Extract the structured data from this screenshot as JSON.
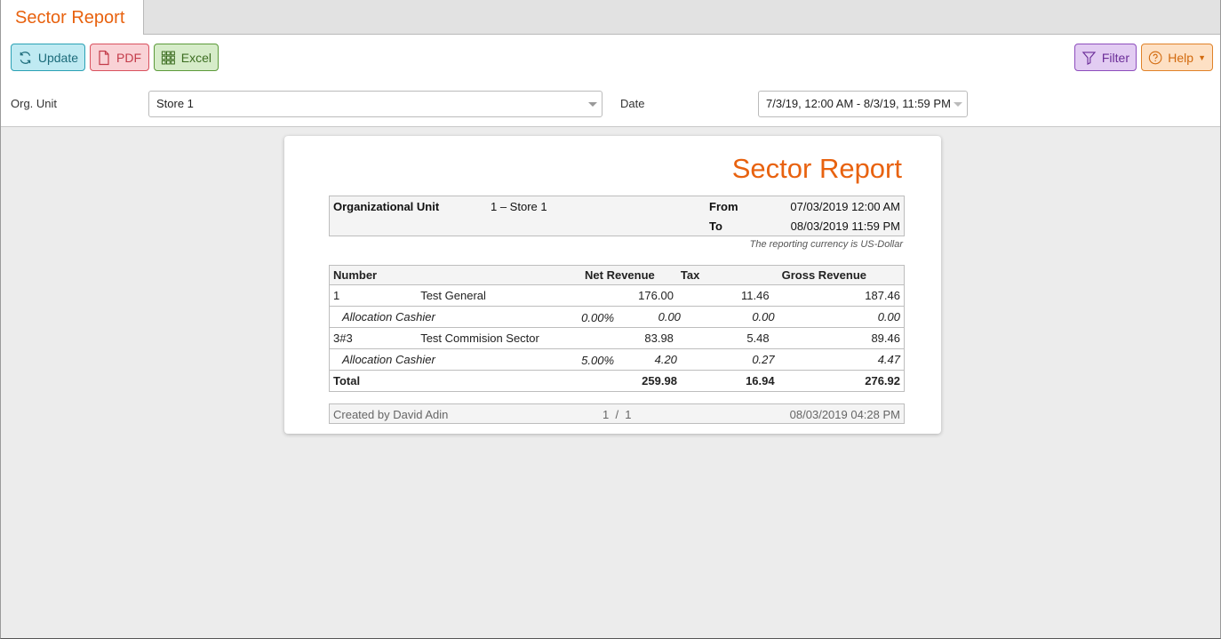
{
  "tab": {
    "label": "Sector Report"
  },
  "toolbar": {
    "update_label": "Update",
    "pdf_label": "PDF",
    "excel_label": "Excel",
    "filter_label": "Filter",
    "help_label": "Help"
  },
  "filters": {
    "org_unit_label": "Org. Unit",
    "org_unit_value": "Store 1",
    "date_label": "Date",
    "date_value": "7/3/19, 12:00 AM - 8/3/19, 11:59 PM"
  },
  "report": {
    "title": "Sector Report",
    "info": {
      "org_unit_label": "Organizational Unit",
      "org_unit_value": "1 – Store 1",
      "from_label": "From",
      "from_value": "07/03/2019 12:00 AM",
      "to_label": "To",
      "to_value": "08/03/2019 11:59 PM"
    },
    "currency_note": "The reporting currency is US-Dollar",
    "columns": {
      "number": "Number",
      "net_revenue": "Net Revenue",
      "tax": "Tax",
      "gross_revenue": "Gross Revenue"
    },
    "rows": [
      {
        "number": "1",
        "name": "Test General",
        "pct": "",
        "net": "176.00",
        "tax": "11.46",
        "gross": "187.46"
      },
      {
        "number": "",
        "name": "Allocation Cashier",
        "pct": "0.00%",
        "net": "0.00",
        "tax": "0.00",
        "gross": "0.00"
      },
      {
        "number": "3#3",
        "name": "Test Commision Sector",
        "pct": "",
        "net": "83.98",
        "tax": "5.48",
        "gross": "89.46"
      },
      {
        "number": "",
        "name": "Allocation Cashier",
        "pct": "5.00%",
        "net": "4.20",
        "tax": "0.27",
        "gross": "4.47"
      }
    ],
    "total": {
      "label": "Total",
      "net": "259.98",
      "tax": "16.94",
      "gross": "276.92"
    },
    "footer": {
      "created_by": "Created by David Adin",
      "page": "1  /  1",
      "timestamp": "08/03/2019 04:28 PM"
    }
  },
  "colors": {
    "accent": "#e8620f",
    "update_bg": "#bfeaf2",
    "pdf_bg": "#f9d2d6",
    "excel_bg": "#d6ecc9",
    "filter_bg": "#e2ccf2",
    "help_bg": "#fde0c4"
  }
}
